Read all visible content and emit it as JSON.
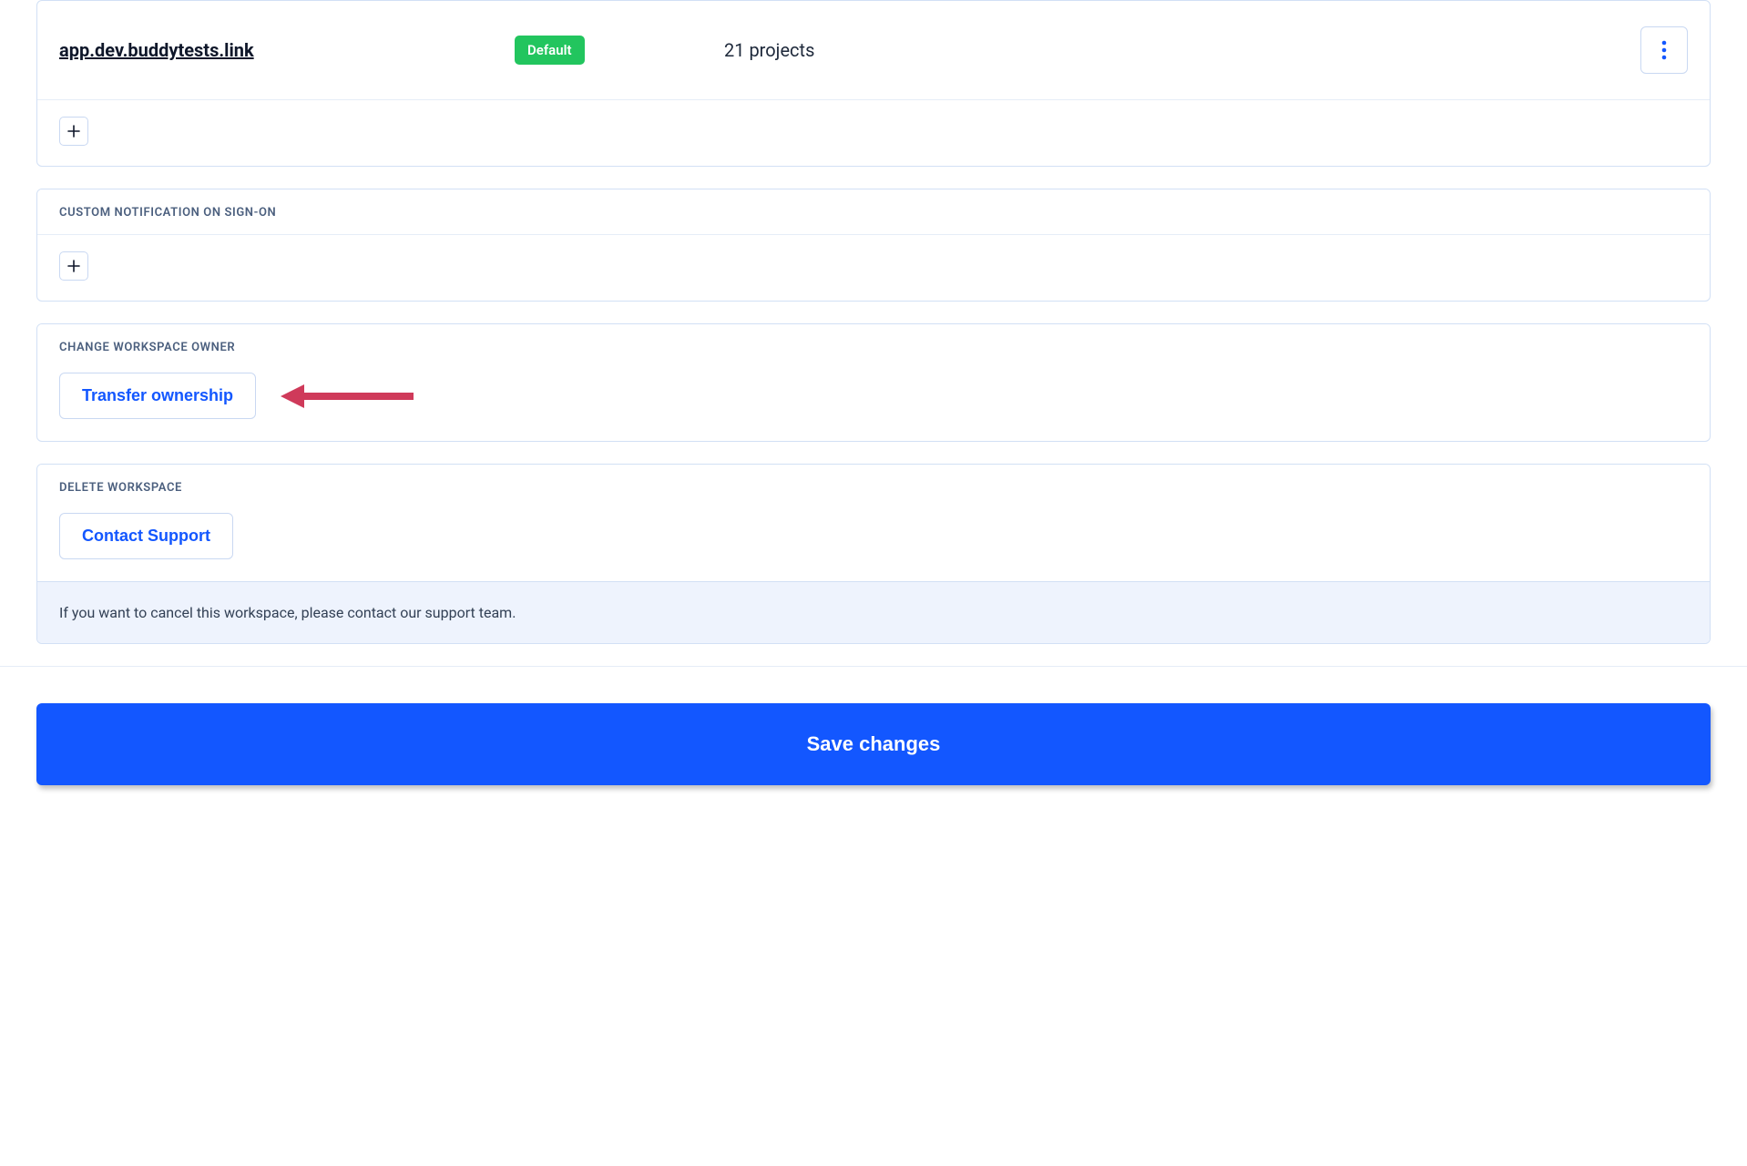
{
  "domains": {
    "row": {
      "name": "app.dev.buddytests.link",
      "badge": "Default",
      "projects": "21 projects"
    }
  },
  "sections": {
    "notification": {
      "title": "CUSTOM NOTIFICATION ON SIGN-ON"
    },
    "owner": {
      "title": "CHANGE WORKSPACE OWNER",
      "button": "Transfer ownership"
    },
    "delete": {
      "title": "DELETE WORKSPACE",
      "button": "Contact Support",
      "note": "If you want to cancel this workspace, please contact our support team."
    }
  },
  "save": {
    "label": "Save changes"
  }
}
